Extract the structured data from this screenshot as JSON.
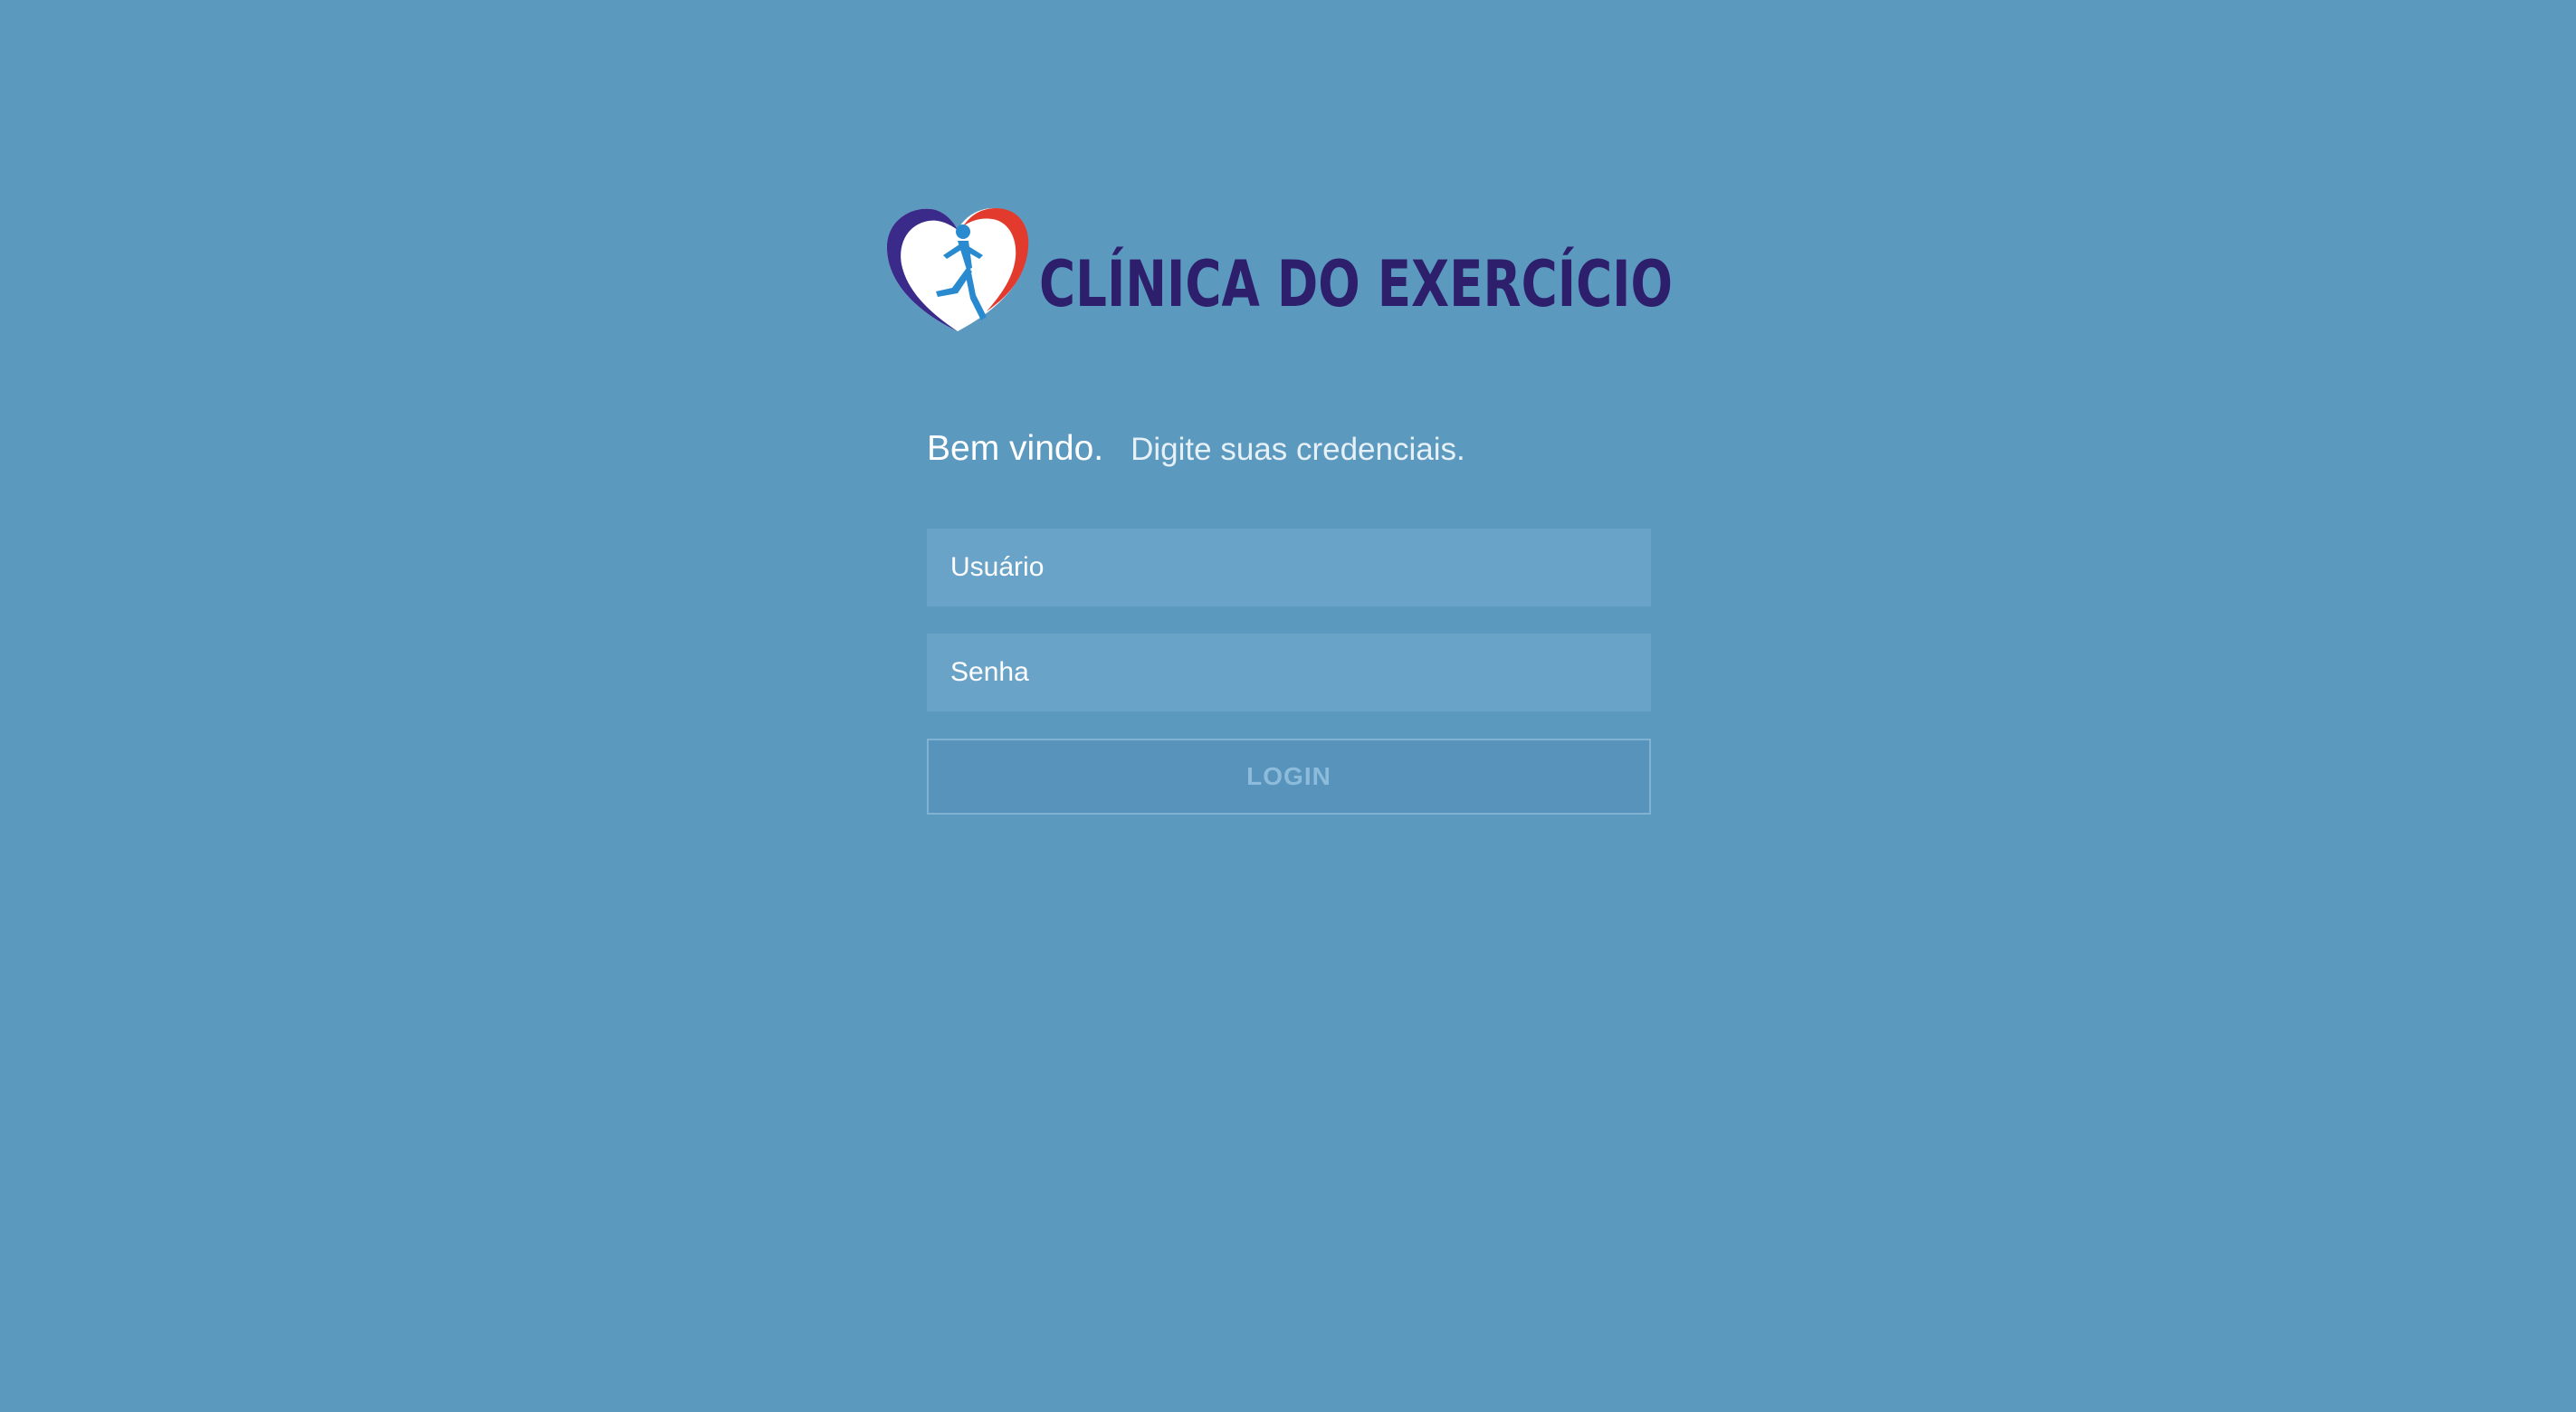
{
  "brand": {
    "name": "Clínica do Exercício",
    "logo_text": "CLÍNICA DO EXERCÍCIO",
    "text_color": "#2d1f6b",
    "heart_left_color": "#3a2a8a",
    "heart_right_color": "#e23b2e",
    "runner_color": "#2a8ad0"
  },
  "login": {
    "title": "Bem vindo.",
    "subtitle": "Digite suas credenciais.",
    "username_placeholder": "Usuário",
    "username_value": "",
    "password_placeholder": "Senha",
    "password_value": "",
    "button_label": "LOGIN"
  },
  "colors": {
    "background": "#5c99bf",
    "field_background": "#69a3c8",
    "button_border": "#7fb2d3",
    "button_text": "#8cbbdb"
  }
}
